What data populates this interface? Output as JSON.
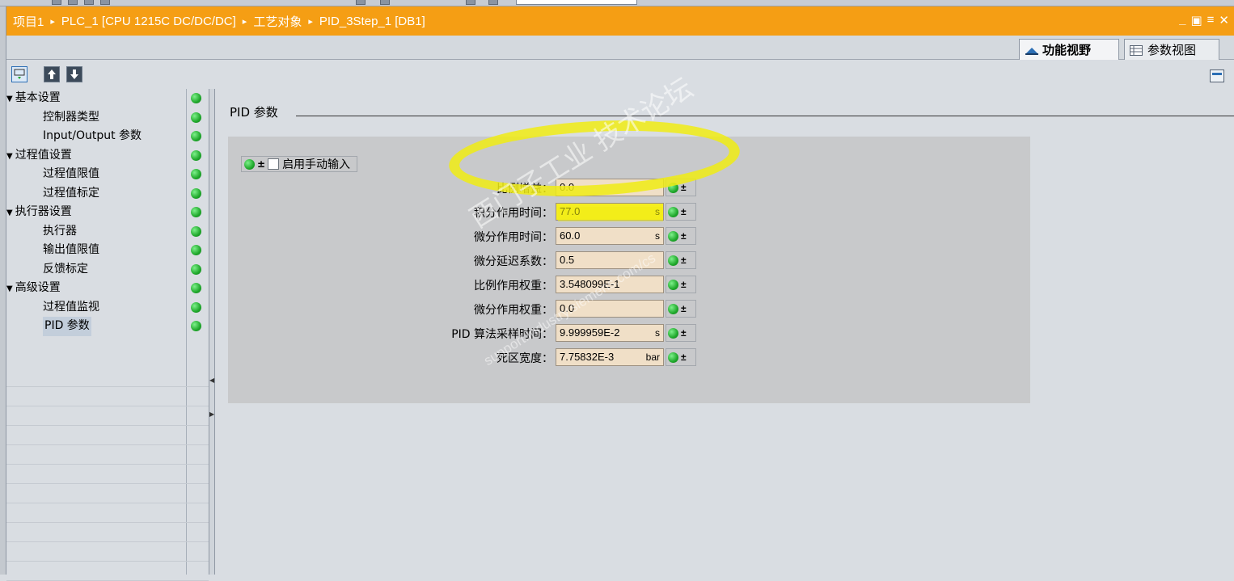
{
  "breadcrumb": [
    "项目1",
    "PLC_1 [CPU 1215C DC/DC/DC]",
    "工艺对象",
    "PID_3Step_1 [DB1]"
  ],
  "breadcrumb_separator": "▸",
  "window_controls": {
    "minimize": "_",
    "restore": "▣",
    "float": "≡",
    "close": "✕"
  },
  "view_tabs": {
    "function_view": "功能视野",
    "param_view": "参数视图"
  },
  "nav": {
    "items": [
      {
        "label": "基本设置",
        "level": 0
      },
      {
        "label": "控制器类型",
        "level": 1
      },
      {
        "label": "Input/Output 参数",
        "level": 1
      },
      {
        "label": "过程值设置",
        "level": 0
      },
      {
        "label": "过程值限值",
        "level": 1
      },
      {
        "label": "过程值标定",
        "level": 1
      },
      {
        "label": "执行器设置",
        "level": 0
      },
      {
        "label": "执行器",
        "level": 1
      },
      {
        "label": "输出值限值",
        "level": 1
      },
      {
        "label": "反馈标定",
        "level": 1
      },
      {
        "label": "高级设置",
        "level": 0
      },
      {
        "label": "过程值监视",
        "level": 1
      },
      {
        "label": "PID 参数",
        "level": 1,
        "selected": true
      }
    ],
    "expand_glyph": "▼"
  },
  "section": {
    "title": "PID 参数"
  },
  "manual_input": {
    "label": "启用手动输入",
    "checked": false
  },
  "params": [
    {
      "label": "比例增益：",
      "value": "0.0",
      "unit": ""
    },
    {
      "label": "积分作用时间：",
      "value": "77.0",
      "unit": "s",
      "highlight": true
    },
    {
      "label": "微分作用时间：",
      "value": "60.0",
      "unit": "s"
    },
    {
      "label": "微分延迟系数：",
      "value": "0.5",
      "unit": ""
    },
    {
      "label": "比例作用权重：",
      "value": "3.548099E-1",
      "unit": ""
    },
    {
      "label": "微分作用权重：",
      "value": "0.0",
      "unit": ""
    },
    {
      "label": "PID 算法采样时间：",
      "value": "9.999959E-2",
      "unit": "s"
    },
    {
      "label": "死区宽度：",
      "value": "7.75832E-3",
      "unit": "bar"
    }
  ],
  "download_glyph": "±",
  "watermark": {
    "main": "西门子工业 技术论坛",
    "sub": "support.industry.siemens.com/cs"
  },
  "colors": {
    "titlebar": "#f59e14",
    "status_ok": "#1fa82b",
    "field_bg": "#f0dfc7",
    "highlight": "#f5ee20"
  }
}
